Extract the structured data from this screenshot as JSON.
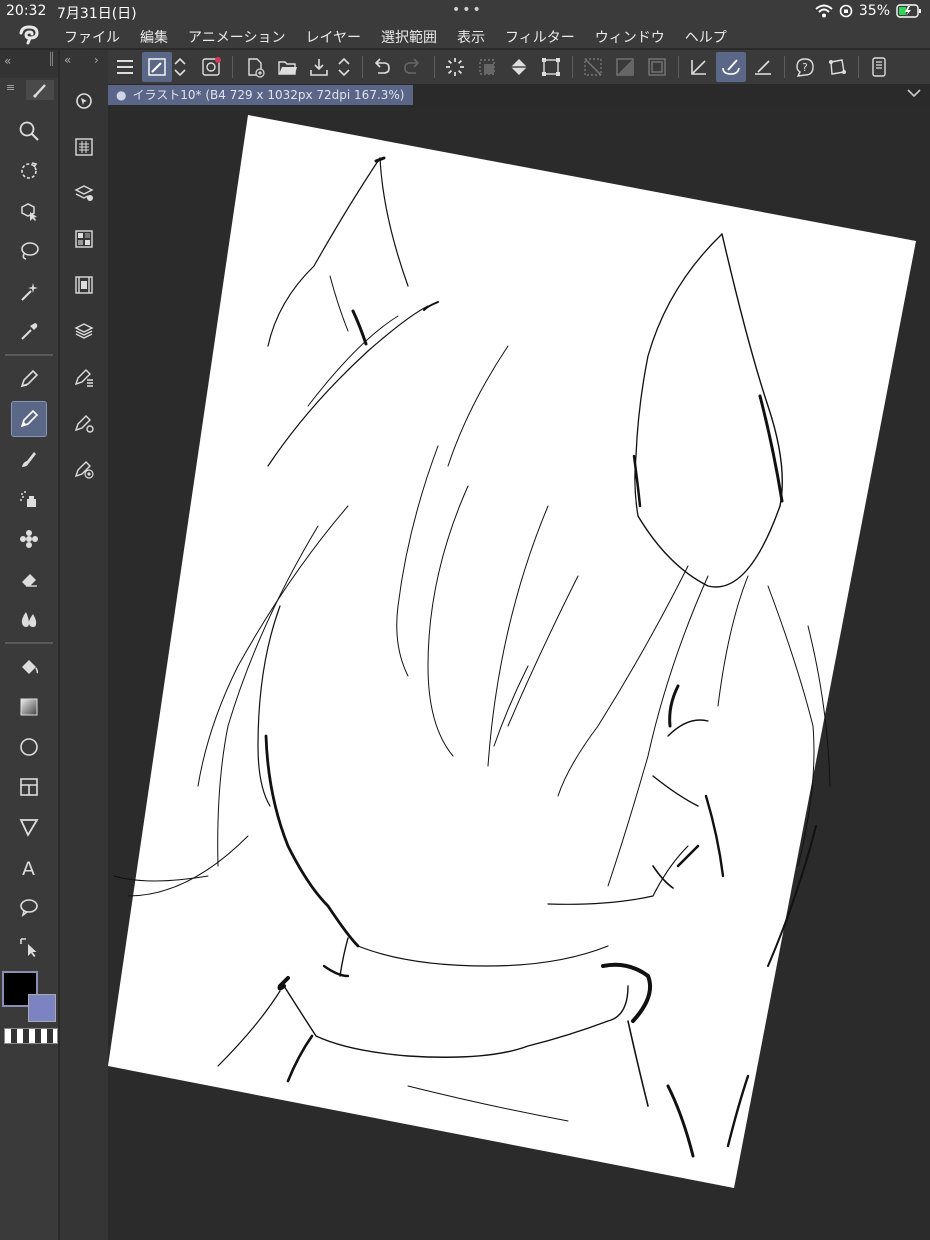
{
  "status_bar": {
    "time": "20:32",
    "date": "7月31日(日)",
    "battery_percent": "35%"
  },
  "menu": {
    "items": [
      "ファイル",
      "編集",
      "アニメーション",
      "レイヤー",
      "選択範囲",
      "表示",
      "フィルター",
      "ウィンドウ",
      "ヘルプ"
    ]
  },
  "document_tab": {
    "label": "イラスト10* (B4 729 x 1032px 72dpi 167.3%)"
  },
  "tools": {
    "main": [
      "zoom-icon",
      "rotate-icon",
      "object-select-icon",
      "lasso-icon",
      "magic-wand-icon",
      "eyedropper-icon",
      "pen-icon",
      "pencil-icon",
      "brush-icon",
      "airbrush-icon",
      "decoration-icon",
      "eraser-icon",
      "blend-icon",
      "fill-icon",
      "gradient-icon",
      "figure-icon",
      "frame-icon",
      "ruler-icon",
      "text-icon",
      "balloon-icon",
      "correct-line-icon"
    ],
    "selected": "pencil-icon",
    "sub_panels": [
      "navigator-icon",
      "layer-property-icon",
      "material-icon",
      "color-set-icon",
      "timeline-icon",
      "layer-icon",
      "sub-tool-icon",
      "tool-property-icon",
      "brush-size-icon"
    ]
  },
  "colors": {
    "main": "#000000",
    "sub": "#7d83c2",
    "accent": "#5b6787",
    "canvas_bg": "#2b2b2b",
    "paper": "#ffffff"
  }
}
